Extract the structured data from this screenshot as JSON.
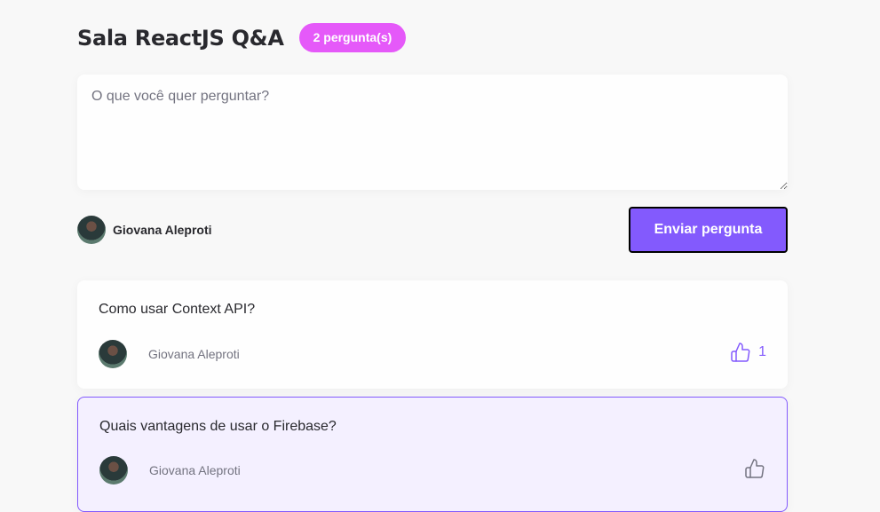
{
  "room": {
    "title": "Sala ReactJS Q&A",
    "badge": "2 pergunta(s)"
  },
  "form": {
    "placeholder": "O que você quer perguntar?",
    "value": "",
    "user_name": "Giovana Aleproti",
    "submit_label": "Enviar pergunta"
  },
  "questions": [
    {
      "content": "Como usar Context API?",
      "author": "Giovana Aleproti",
      "like_count": "1",
      "liked": true,
      "like_icon": "thumbs-up-icon"
    },
    {
      "content": "Quais vantagens de usar o Firebase?",
      "author": "Giovana Aleproti",
      "like_count": "",
      "liked": false,
      "like_icon": "thumbs-up-icon"
    }
  ],
  "colors": {
    "accent": "#835afd",
    "badge": "#e559f9",
    "highlight_bg": "#f4f0ff",
    "muted": "#737380"
  }
}
